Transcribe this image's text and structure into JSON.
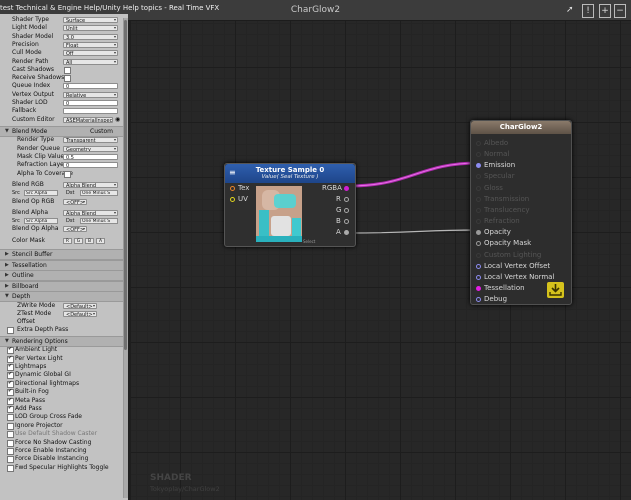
{
  "window": {
    "tab_text": "test Technical & Engine Help/Unity Help topics - Real Time VFX",
    "title": "CharGlow2"
  },
  "toolbar_icons": [
    "share-icon",
    "info-icon",
    "plus-icon",
    "minus-icon"
  ],
  "inspector": {
    "rows1": [
      {
        "label": "Shader Type",
        "value": "Surface",
        "kind": "dropdown"
      },
      {
        "label": "Light Model",
        "value": "Unlit",
        "kind": "dropdown"
      },
      {
        "label": "Shader Model",
        "value": "3.0",
        "kind": "dropdown"
      },
      {
        "label": "Precision",
        "value": "Float",
        "kind": "dropdown"
      },
      {
        "label": "Cull Mode",
        "value": "Off",
        "kind": "dropdown"
      },
      {
        "label": "Render Path",
        "value": "All",
        "kind": "dropdown"
      },
      {
        "label": "Cast Shadows",
        "value": "",
        "kind": "check"
      },
      {
        "label": "Receive Shadows",
        "value": "",
        "kind": "check"
      },
      {
        "label": "Queue Index",
        "value": "0",
        "kind": "number"
      },
      {
        "label": "Vertex Output",
        "value": "Relative",
        "kind": "dropdown"
      },
      {
        "label": "Shader LOD",
        "value": "0",
        "kind": "number"
      },
      {
        "label": "Fallback",
        "value": "",
        "kind": "number"
      },
      {
        "label": "Custom Editor",
        "value": "ASEMaterialInspec",
        "kind": "text"
      }
    ],
    "blend_mode": {
      "label": "Blend Mode",
      "value": "Custom",
      "render_type": {
        "label": "Render Type",
        "value": "Transparent"
      },
      "render_queue": {
        "label": "Render Queue",
        "value": "Geometry"
      },
      "mask_clip": {
        "label": "Mask Clip Value",
        "value": "0.5"
      },
      "refraction": {
        "label": "Refraction Layer",
        "value": "0"
      },
      "alpha_coverage": {
        "label": "Alpha To Coverage"
      },
      "blend_rgb": {
        "label": "Blend RGB",
        "value": "Alpha Blend"
      },
      "src_label": "Src",
      "dst_label": "Dst",
      "src_rgb": "Src Alpha",
      "dst_rgb": "One Minus S",
      "blend_op_rgb": {
        "label": "Blend Op RGB",
        "value": "<OFF>"
      },
      "blend_alpha": {
        "label": "Blend Alpha",
        "value": "Alpha Blend"
      },
      "src_alpha": "Src Alpha",
      "dst_alpha": "One Minus S",
      "blend_op_alpha": {
        "label": "Blend Op Alpha",
        "value": "<OFF>"
      },
      "color_mask": {
        "label": "Color Mask",
        "channels": [
          "R",
          "G",
          "B",
          "A"
        ]
      }
    },
    "sections": [
      "Stencil Buffer",
      "Tessellation",
      "Outline",
      "Billboard"
    ],
    "depth": {
      "label": "Depth",
      "zwrite": {
        "label": "ZWrite Mode",
        "value": "<Default>"
      },
      "ztest": {
        "label": "ZTest Mode",
        "value": "<Default>"
      },
      "offset": "Offset",
      "extra": "Extra Depth Pass"
    },
    "rendering_options": {
      "label": "Rendering Options",
      "items": [
        {
          "label": "Ambient Light",
          "checked": true,
          "disabled": false
        },
        {
          "label": "Per Vertex Light",
          "checked": true,
          "disabled": false
        },
        {
          "label": "Lightmaps",
          "checked": true,
          "disabled": false
        },
        {
          "label": "Dynamic Global GI",
          "checked": true,
          "disabled": false
        },
        {
          "label": "Directional lightmaps",
          "checked": true,
          "disabled": false
        },
        {
          "label": "Built-in Fog",
          "checked": true,
          "disabled": false
        },
        {
          "label": "Meta Pass",
          "checked": true,
          "disabled": false
        },
        {
          "label": "Add Pass",
          "checked": true,
          "disabled": false
        },
        {
          "label": "LOD Group Cross Fade",
          "checked": false,
          "disabled": false
        },
        {
          "label": "Ignore Projector",
          "checked": false,
          "disabled": false
        },
        {
          "label": "Use Default Shadow Caster",
          "checked": false,
          "disabled": true
        },
        {
          "label": "Force No Shadow Casting",
          "checked": false,
          "disabled": false
        },
        {
          "label": "Force Enable Instancing",
          "checked": false,
          "disabled": false
        },
        {
          "label": "Force Disable Instancing",
          "checked": false,
          "disabled": false
        },
        {
          "label": "Fwd Specular Highlights Toggle",
          "checked": false,
          "disabled": false
        }
      ]
    }
  },
  "texture_node": {
    "title": "Texture Sample 0",
    "subtitle": "Value( Seal Texture )",
    "inputs": [
      "Tex",
      "UV"
    ],
    "outputs": [
      "RGBA",
      "R",
      "G",
      "B",
      "A"
    ],
    "select_label": "Select",
    "colors": {
      "rgba": "#d21fd2",
      "tex": "#e8832a",
      "uv": "#e0d51d"
    }
  },
  "charglow_node": {
    "title": "CharGlow2",
    "ports": [
      {
        "label": "Albedo",
        "active": false,
        "color": "#3a3a3a"
      },
      {
        "label": "Normal",
        "active": false,
        "color": "#3a3a3a"
      },
      {
        "label": "Emission",
        "active": true,
        "color": "#8c8cf0"
      },
      {
        "label": "Specular",
        "active": false,
        "color": "#3a3a3a"
      },
      {
        "label": "Gloss",
        "active": false,
        "color": "#3a3a3a"
      },
      {
        "label": "Transmission",
        "active": false,
        "color": "#3a3a3a"
      },
      {
        "label": "Translucency",
        "active": false,
        "color": "#3a3a3a"
      },
      {
        "label": "Refraction",
        "active": false,
        "color": "#3a3a3a"
      },
      {
        "label": "Opacity",
        "active": true,
        "color": "#9a9a9a"
      },
      {
        "label": "Opacity Mask",
        "active": true,
        "color": "#9a9a9a"
      },
      {
        "label": "Custom Lighting",
        "active": false,
        "color": "#3a3a3a"
      },
      {
        "label": "Local Vertex Offset",
        "active": true,
        "color": "#8c8cf0"
      },
      {
        "label": "Local Vertex Normal",
        "active": true,
        "color": "#8c8cf0"
      },
      {
        "label": "Tessellation",
        "active": true,
        "color": "#e31ee3"
      },
      {
        "label": "Debug",
        "active": true,
        "color": "#8c8cf0"
      }
    ]
  },
  "watermark": {
    "title": "SHADER",
    "path": "Tokyoplay/CharGlow2"
  }
}
